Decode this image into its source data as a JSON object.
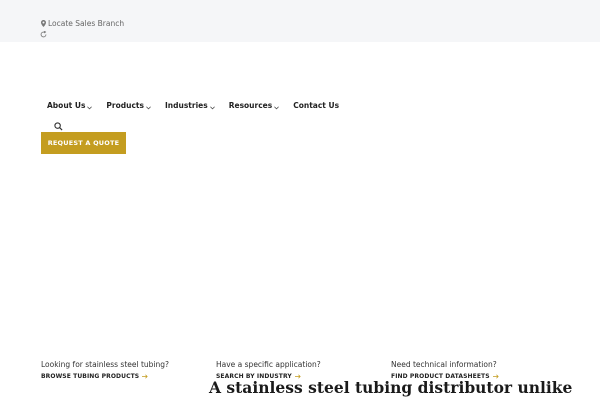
{
  "topbar": {
    "locate_label": "Locate Sales Branch",
    "icons": [
      "map-pin-icon",
      "refresh-icon"
    ]
  },
  "nav": {
    "items": [
      {
        "label": "About Us",
        "has_dropdown": true
      },
      {
        "label": "Products",
        "has_dropdown": true
      },
      {
        "label": "Industries",
        "has_dropdown": true
      },
      {
        "label": "Resources",
        "has_dropdown": true
      },
      {
        "label": "Contact Us",
        "has_dropdown": false
      }
    ]
  },
  "header": {
    "search_icon": "search-icon",
    "quote_button": "REQUEST A QUOTE",
    "quote_color": "#c49d20"
  },
  "promos": [
    {
      "question": "Looking for stainless steel tubing?",
      "link": "BROWSE TUBING PRODUCTS"
    },
    {
      "question": "Have a specific application?",
      "link": "SEARCH BY INDUSTRY"
    },
    {
      "question": "Need technical information?",
      "link": "FIND PRODUCT DATASHEETS"
    }
  ],
  "hero": {
    "headline": "A stainless steel tubing distributor unlike"
  }
}
